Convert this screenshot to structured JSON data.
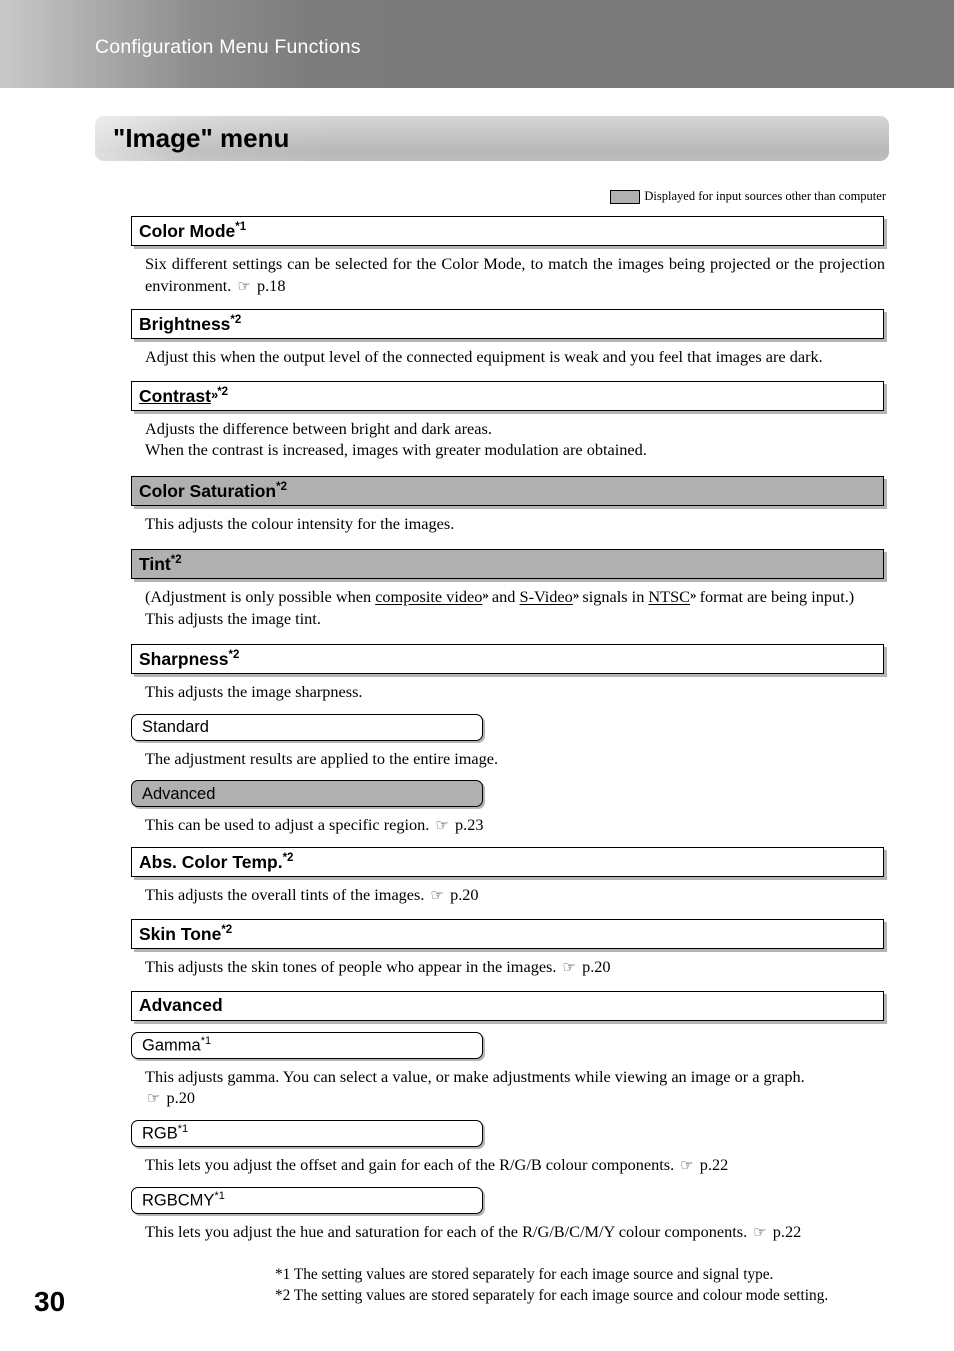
{
  "header": {
    "running_title": "Configuration Menu Functions"
  },
  "banner": {
    "title": "\"Image\" menu"
  },
  "legend": {
    "swatch_color": "#b0b0b0",
    "label": "Displayed for input sources other than computer"
  },
  "items": [
    {
      "name": "color-mode",
      "title": "Color Mode",
      "footnote": "*1",
      "filled": false,
      "glossary": false,
      "body": "Six different settings can be selected for the Color Mode, to match the images being projected or the projection environment.",
      "page_ref": "p.18"
    },
    {
      "name": "brightness",
      "title": "Brightness",
      "footnote": "*2",
      "filled": false,
      "glossary": false,
      "body": "Adjust this when the output level of the connected equipment is weak and you feel that images are dark.",
      "page_ref": ""
    },
    {
      "name": "contrast",
      "title": "Contrast",
      "footnote": "*2",
      "filled": false,
      "glossary": true,
      "body_line1": "Adjusts the difference between bright and dark areas.",
      "body_line2": "When the contrast is increased, images with greater modulation are obtained.",
      "page_ref": ""
    },
    {
      "name": "color-saturation",
      "title": "Color Saturation",
      "footnote": "*2",
      "filled": true,
      "glossary": false,
      "body": "This adjusts the colour intensity for the images.",
      "page_ref": ""
    },
    {
      "name": "tint",
      "title": "Tint",
      "footnote": "*2",
      "filled": true,
      "glossary": false,
      "body_pre": "(Adjustment is only possible when ",
      "term1": "composite video",
      "body_mid1": " and ",
      "term2": "S-Video",
      "body_mid2": " signals in ",
      "term3": "NTSC",
      "body_post": " format are being input.)",
      "body_line2": "This adjusts the image tint.",
      "page_ref": ""
    },
    {
      "name": "sharpness",
      "title": "Sharpness",
      "footnote": "*2",
      "filled": false,
      "glossary": false,
      "body": "This adjusts the image sharpness.",
      "page_ref": ""
    }
  ],
  "sharpness_subs": [
    {
      "name": "standard",
      "title": "Standard",
      "footnote": "",
      "filled": false,
      "body": "The adjustment results are applied to the entire image.",
      "page_ref": ""
    },
    {
      "name": "advanced",
      "title": "Advanced",
      "footnote": "",
      "filled": true,
      "body": "This can be used to adjust a specific region.",
      "page_ref": "p.23"
    }
  ],
  "items2": [
    {
      "name": "abs-color-temp",
      "title": "Abs. Color Temp.",
      "footnote": "*2",
      "filled": false,
      "body": "This adjusts the overall tints of the images.",
      "page_ref": "p.20"
    },
    {
      "name": "skin-tone",
      "title": "Skin Tone",
      "footnote": "*2",
      "filled": false,
      "body": "This adjusts the skin tones of people who appear in the images.",
      "page_ref": "p.20"
    }
  ],
  "advanced_group": {
    "name": "advanced",
    "title": "Advanced",
    "footnote": "",
    "filled": false
  },
  "advanced_subs": [
    {
      "name": "gamma",
      "title": "Gamma",
      "footnote": "*1",
      "filled": false,
      "body": "This adjusts gamma. You can select a value, or make adjustments while viewing an image or a graph.",
      "page_ref": "p.20",
      "ref_on_new_line": true
    },
    {
      "name": "rgb",
      "title": "RGB",
      "footnote": "*1",
      "filled": false,
      "body": "This lets you adjust the offset and gain for each of the R/G/B colour components.",
      "page_ref": "p.22",
      "ref_on_new_line": false
    },
    {
      "name": "rgbcmy",
      "title": "RGBCMY",
      "footnote": "*1",
      "filled": false,
      "body": "This lets you adjust the hue and saturation for each of the R/G/B/C/M/Y colour components.",
      "page_ref": "p.22",
      "ref_on_new_line": false
    }
  ],
  "footnotes": {
    "line1": "*1 The setting values are stored separately for each image source and signal type.",
    "line2": "*2 The setting values are stored separately for each image source and colour mode setting."
  },
  "page_number": "30",
  "icons": {
    "page_ref_icon": "pointing-hand-icon",
    "glossary_icon": "double-chevron-icon"
  }
}
